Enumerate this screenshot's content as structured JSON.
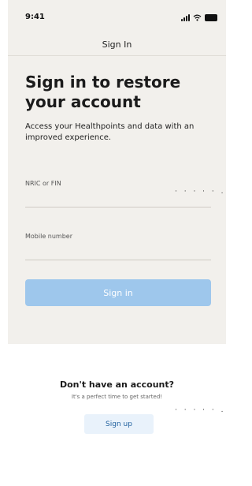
{
  "status_bar": {
    "time": "9:41",
    "icons": [
      "signal-icon",
      "wifi-icon",
      "battery-icon"
    ]
  },
  "header": {
    "title": "Sign In"
  },
  "main": {
    "headline": "Sign in to restore your account",
    "subtext": "Access your Healthpoints and data with an improved experience.",
    "fields": [
      {
        "label": "NRIC or FIN",
        "value": ""
      },
      {
        "label": "Mobile number",
        "value": ""
      }
    ],
    "signin_label": "Sign in"
  },
  "signup": {
    "title": "Don't have an account?",
    "subtitle": "It's a perfect time to get started!",
    "button_label": "Sign up"
  },
  "annotations": {
    "dots": "· · · · · ."
  },
  "colors": {
    "primary_button": "#9ec7ec",
    "secondary_button": "#e9f2fb",
    "background": "#f2f0ec"
  }
}
